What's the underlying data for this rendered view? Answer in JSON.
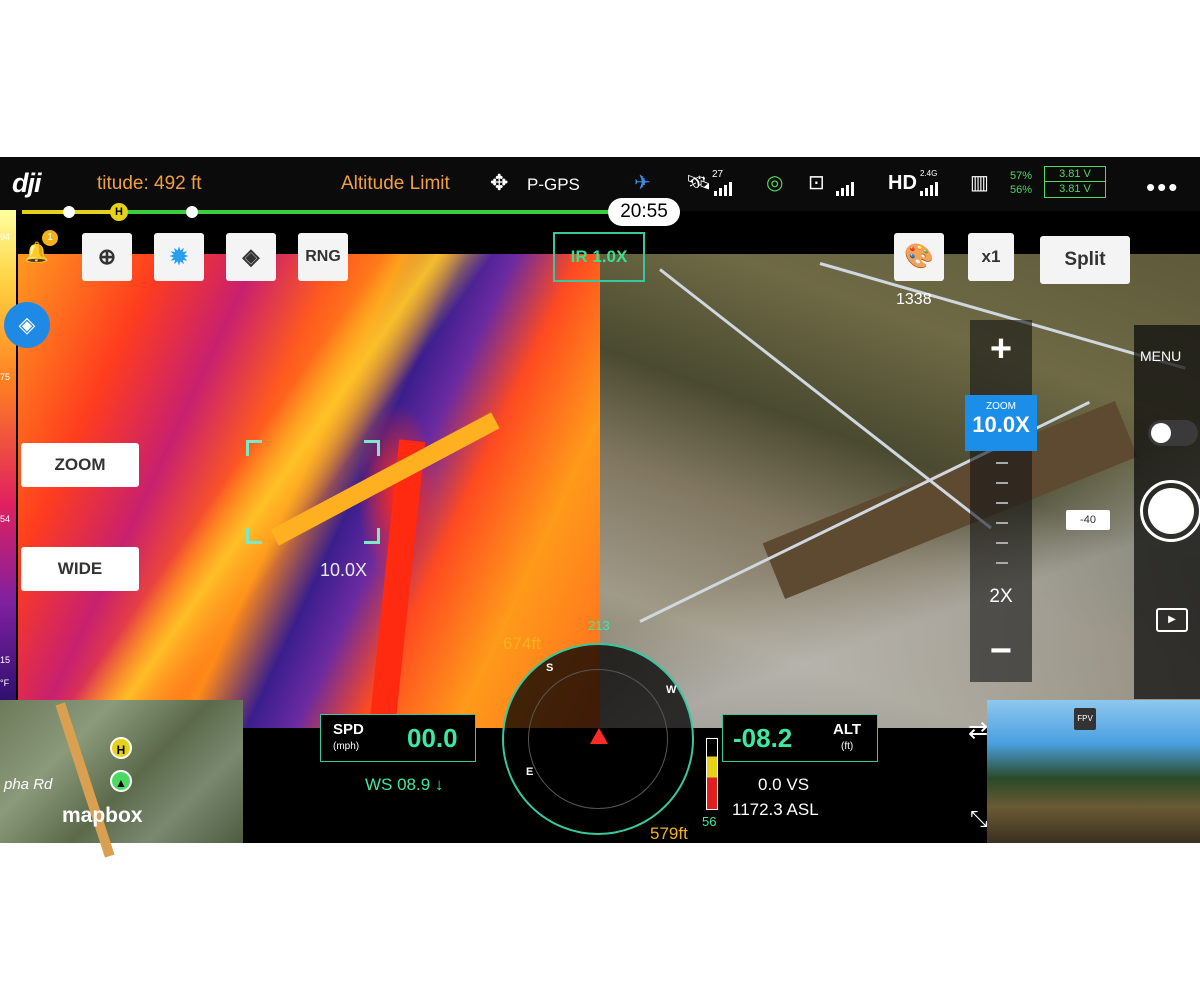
{
  "top_bar": {
    "logo": "dji",
    "altitude_text": "titude: 492 ft",
    "altitude_limit": "Altitude Limit",
    "gps_mode": "P-GPS",
    "satellite_count": "27",
    "hd_label": "HD",
    "hd_band": "2.4G",
    "battery_pct_1": "57%",
    "battery_pct_2": "56%",
    "battery_volt_1": "3.81 V",
    "battery_volt_2": "3.81 V",
    "menu_icon": "more-dots-icon"
  },
  "timeline": {
    "flight_time": "20:55",
    "home_marker": "H"
  },
  "left_controls": {
    "notification_count": "1",
    "rng_label": "RNG",
    "zoom_button": "ZOOM",
    "wide_button": "WIDE",
    "palette_labels": [
      "94",
      "75",
      "54",
      "15",
      "°F"
    ]
  },
  "thermal": {
    "ir_badge": "IR 1.0X",
    "zoom_overlay": "10.0X"
  },
  "right_controls": {
    "x1_label": "x1",
    "split_label": "Split",
    "recording_count": "1338",
    "zoom_title": "ZOOM",
    "zoom_value": "10.0X",
    "zoom_2x": "2X",
    "ev_value": "-40",
    "menu_label": "MENU"
  },
  "hud": {
    "spd_label": "SPD",
    "spd_unit": "(mph)",
    "spd_value": "00.0",
    "wind_speed": "WS 08.9 ↓",
    "alt_label": "ALT",
    "alt_unit": "(ft)",
    "alt_value": "-08.2",
    "vs_text": "0.0  VS",
    "asl_text": "1172.3 ASL",
    "bar_value": "56",
    "dist_top": "674ft",
    "dist_bottom": "579ft",
    "heading": "213",
    "compass_s": "S",
    "compass_w": "W",
    "compass_e": "E"
  },
  "map": {
    "road_label": "pha Rd",
    "logo": "mapbox"
  },
  "fpv": {
    "label": "FPV"
  }
}
